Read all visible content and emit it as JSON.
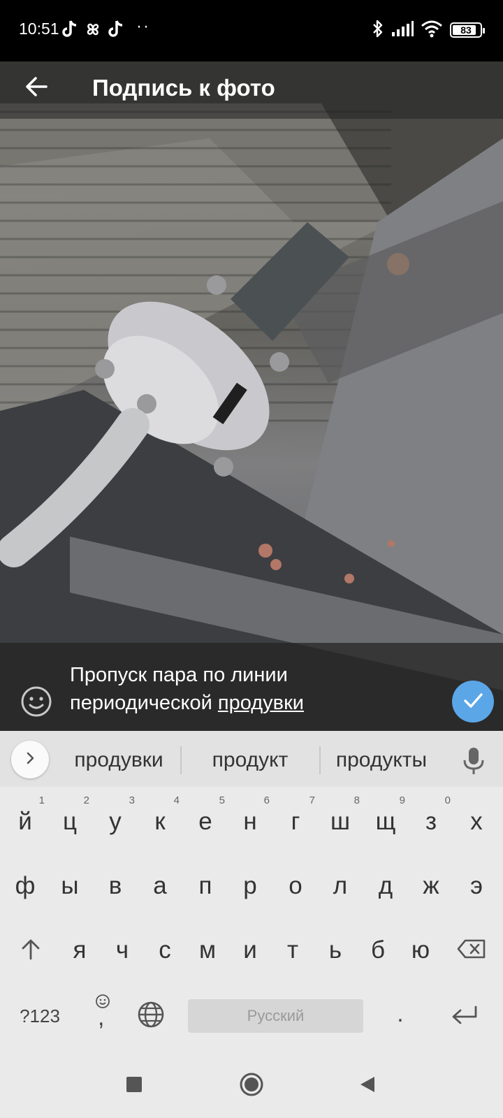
{
  "status_bar": {
    "time": "10:51",
    "dots": "··",
    "battery": "83",
    "icons": [
      "tiktok-icon",
      "pinwheel-icon",
      "tiktok-icon",
      "bluetooth-icon",
      "signal-icon",
      "wifi-icon",
      "battery-icon"
    ]
  },
  "app_bar": {
    "title": "Подпись к фото",
    "back_icon": "arrow-back-icon"
  },
  "caption": {
    "line1": "Пропуск пара по линии",
    "line2_plain": "периодической ",
    "line2_underlined": "продувки",
    "emoji_icon": "smiley-icon",
    "done_icon": "check-icon",
    "accent_color": "#5aa6e6"
  },
  "keyboard": {
    "suggestions": [
      "продувки",
      "продукт",
      "продукты"
    ],
    "row1": [
      {
        "k": "й",
        "h": "1"
      },
      {
        "k": "ц",
        "h": "2"
      },
      {
        "k": "у",
        "h": "3"
      },
      {
        "k": "к",
        "h": "4"
      },
      {
        "k": "е",
        "h": "5"
      },
      {
        "k": "н",
        "h": "6"
      },
      {
        "k": "г",
        "h": "7"
      },
      {
        "k": "ш",
        "h": "8"
      },
      {
        "k": "щ",
        "h": "9"
      },
      {
        "k": "з",
        "h": "0"
      },
      {
        "k": "х",
        "h": ""
      }
    ],
    "row2": [
      "ф",
      "ы",
      "в",
      "а",
      "п",
      "р",
      "о",
      "л",
      "д",
      "ж",
      "э"
    ],
    "row3": [
      "я",
      "ч",
      "с",
      "м",
      "и",
      "т",
      "ь",
      "б",
      "ю"
    ],
    "sym_label": "?123",
    "comma": ",",
    "space_label": "Русский",
    "period": "."
  },
  "nav_bar": {
    "buttons": [
      "recents-square-icon",
      "home-circle-icon",
      "back-triangle-icon"
    ]
  }
}
